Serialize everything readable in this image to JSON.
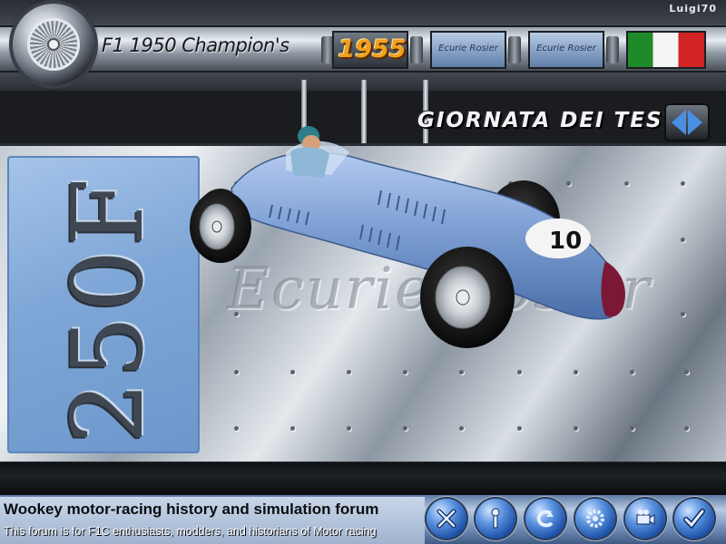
{
  "header": {
    "app_title": "F1 1950 Champion's",
    "season_year": "1955",
    "track_button_1": "Ecurie Rosier",
    "track_button_2": "Ecurie Rosier",
    "username": "Luigi70",
    "flag_colors": [
      "#1f8a2a",
      "#f4f4f4",
      "#d22424"
    ]
  },
  "mode": {
    "title": "GIORNATA DEI TEST",
    "nav_icon": "left-right-arrows-icon"
  },
  "car_panel": {
    "model": "250F",
    "team_watermark": "Ecurie Rosier",
    "car_color": "#7ea0d4",
    "car_number": "10"
  },
  "footer": {
    "forum_title": "Wookey motor-racing history and simulation forum",
    "forum_description": "This forum is for F1C enthusiasts, modders, and historians of Motor racing",
    "buttons": [
      {
        "icon": "close-x-icon"
      },
      {
        "icon": "tools-icon"
      },
      {
        "icon": "back-icon"
      },
      {
        "icon": "settings-gear-icon"
      },
      {
        "icon": "camera-icon"
      },
      {
        "icon": "checkmark-icon"
      }
    ]
  }
}
